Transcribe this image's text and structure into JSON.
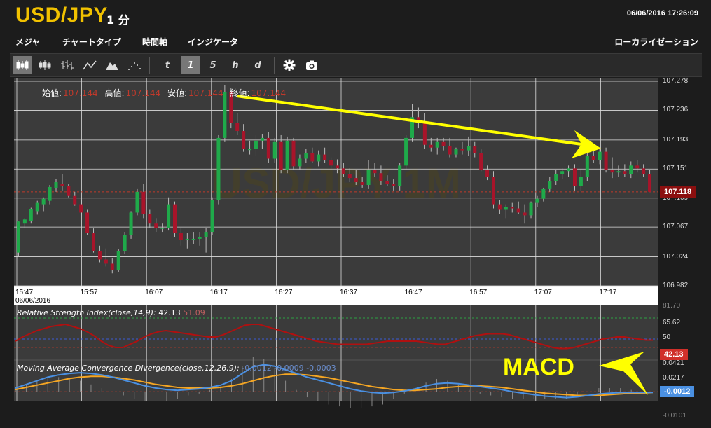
{
  "header": {
    "pair": "USD/JPY",
    "interval": "1 分",
    "datetime": "06/06/2016 17:26:09"
  },
  "menu": {
    "items": [
      "メジャ",
      "チャートタイプ",
      "時間軸",
      "インジケータ"
    ],
    "right": "ローカライゼーション"
  },
  "toolbar": {
    "chart_types": [
      "candlestick-icon",
      "ohlc-icon",
      "hlc-icon",
      "line-chart-icon",
      "mountain-chart-icon",
      "dots-chart-icon"
    ],
    "timeframes": [
      "t",
      "1",
      "5",
      "h",
      "d"
    ],
    "active_timeframe": "1",
    "tools": [
      "gear-icon",
      "camera-icon"
    ]
  },
  "legend": {
    "open_label": "始値:",
    "open_value": "107.144",
    "high_label": "高値:",
    "high_value": "107.144",
    "low_label": "安値:",
    "low_value": "107.144",
    "close_label": "終値:",
    "close_value": "107.144"
  },
  "rsi_panel": {
    "name": "Relative Strength Index",
    "params": "(close,14,9):",
    "value": "42.13",
    "value2": "51.09",
    "ticks": [
      "81.70",
      "65.62",
      "50"
    ],
    "current_badge": "42.13"
  },
  "macd_panel": {
    "name": "Moving Average Convergence Divergence",
    "params": "(close,12,26,9):",
    "values": [
      "-0.0012",
      "-0.0009",
      "-0.0003"
    ],
    "ticks": [
      "0.0421",
      "0.0217",
      "-0.0101"
    ],
    "current_badge": "-0.0012",
    "annotation": "MACD"
  },
  "colors": {
    "accent": "#f2c200",
    "up": "#1faa4a",
    "down": "#a8142a",
    "rsi_line": "#b01010",
    "macd_line": "#4a90e2",
    "signal_line": "#f5a623",
    "annotation": "#ffff00",
    "price_badge": "#8b0f0f",
    "macd_badge": "#4a90e2",
    "rsi_badge": "#d0302a"
  },
  "chart_data": {
    "type": "candlestick",
    "ylim": [
      106.982,
      107.278
    ],
    "yticks": [
      "107.278",
      "107.236",
      "107.193",
      "107.151",
      "107.109",
      "107.067",
      "107.024",
      "106.982"
    ],
    "current_price": "107.118",
    "xticks": [
      "15:47",
      "15:57",
      "16:07",
      "16:17",
      "16:27",
      "16:37",
      "16:47",
      "16:57",
      "17:07",
      "17:17"
    ],
    "date_label": "06/06/2016",
    "watermark": "USD/JPY 1M",
    "candles": [
      [
        107.03,
        107.075,
        107.025,
        107.075
      ],
      [
        107.072,
        107.08,
        107.065,
        107.078
      ],
      [
        107.076,
        107.095,
        107.072,
        107.093
      ],
      [
        107.09,
        107.105,
        107.085,
        107.102
      ],
      [
        107.1,
        107.11,
        107.09,
        107.108
      ],
      [
        107.105,
        107.128,
        107.1,
        107.125
      ],
      [
        107.123,
        107.137,
        107.118,
        107.132
      ],
      [
        107.13,
        107.144,
        107.12,
        107.126
      ],
      [
        107.126,
        107.13,
        107.11,
        107.112
      ],
      [
        107.112,
        107.118,
        107.098,
        107.1
      ],
      [
        107.1,
        107.106,
        107.085,
        107.088
      ],
      [
        107.088,
        107.092,
        107.055,
        107.058
      ],
      [
        107.058,
        107.065,
        107.03,
        107.032
      ],
      [
        107.032,
        107.04,
        107.016,
        107.02
      ],
      [
        107.02,
        107.036,
        107.01,
        107.014
      ],
      [
        107.014,
        107.022,
        107.0,
        107.005
      ],
      [
        107.005,
        107.035,
        107.002,
        107.032
      ],
      [
        107.032,
        107.06,
        107.028,
        107.056
      ],
      [
        107.056,
        107.09,
        107.05,
        107.088
      ],
      [
        107.088,
        107.122,
        107.084,
        107.118
      ],
      [
        107.118,
        107.13,
        107.08,
        107.086
      ],
      [
        107.086,
        107.092,
        107.066,
        107.072
      ],
      [
        107.072,
        107.08,
        107.06,
        107.066
      ],
      [
        107.066,
        107.072,
        107.06,
        107.066
      ],
      [
        107.066,
        107.11,
        107.062,
        107.1
      ],
      [
        107.1,
        107.104,
        107.052,
        107.058
      ],
      [
        107.058,
        107.066,
        107.04,
        107.048
      ],
      [
        107.048,
        107.058,
        107.036,
        107.05
      ],
      [
        107.05,
        107.06,
        107.042,
        107.05
      ],
      [
        107.05,
        107.06,
        107.04,
        107.052
      ],
      [
        107.052,
        107.066,
        107.03,
        107.06
      ],
      [
        107.06,
        107.11,
        107.055,
        107.106
      ],
      [
        107.106,
        107.2,
        107.1,
        107.196
      ],
      [
        107.196,
        107.272,
        107.19,
        107.262
      ],
      [
        107.262,
        107.268,
        107.21,
        107.218
      ],
      [
        107.218,
        107.232,
        107.2,
        107.206
      ],
      [
        107.206,
        107.216,
        107.176,
        107.18
      ],
      [
        107.18,
        107.192,
        107.172,
        107.18
      ],
      [
        107.18,
        107.2,
        107.17,
        107.192
      ],
      [
        107.192,
        107.202,
        107.18,
        107.196
      ],
      [
        107.196,
        107.205,
        107.16,
        107.166
      ],
      [
        107.166,
        107.196,
        107.16,
        107.19
      ],
      [
        107.19,
        107.2,
        107.145,
        107.15
      ],
      [
        107.15,
        107.198,
        107.145,
        107.192
      ],
      [
        107.192,
        107.196,
        107.15,
        107.155
      ],
      [
        107.155,
        107.172,
        107.15,
        107.166
      ],
      [
        107.166,
        107.18,
        107.16,
        107.174
      ],
      [
        107.174,
        107.182,
        107.16,
        107.162
      ],
      [
        107.162,
        107.178,
        107.155,
        107.172
      ],
      [
        107.172,
        107.182,
        107.16,
        107.164
      ],
      [
        107.164,
        107.168,
        107.15,
        107.156
      ],
      [
        107.156,
        107.165,
        107.145,
        107.152
      ],
      [
        107.152,
        107.16,
        107.14,
        107.144
      ],
      [
        107.144,
        107.152,
        107.132,
        107.138
      ],
      [
        107.138,
        107.15,
        107.128,
        107.132
      ],
      [
        107.132,
        107.14,
        107.124,
        107.128
      ],
      [
        107.128,
        107.164,
        107.122,
        107.15
      ],
      [
        107.15,
        107.16,
        107.14,
        107.145
      ],
      [
        107.145,
        107.156,
        107.128,
        107.134
      ],
      [
        107.134,
        107.142,
        107.126,
        107.13
      ],
      [
        107.13,
        107.136,
        107.12,
        107.126
      ],
      [
        107.126,
        107.16,
        107.12,
        107.156
      ],
      [
        107.156,
        107.2,
        107.15,
        107.196
      ],
      [
        107.196,
        107.245,
        107.19,
        107.226
      ],
      [
        107.226,
        107.24,
        107.21,
        107.22
      ],
      [
        107.22,
        107.232,
        107.18,
        107.186
      ],
      [
        107.186,
        107.196,
        107.176,
        107.182
      ],
      [
        107.182,
        107.196,
        107.172,
        107.19
      ],
      [
        107.19,
        107.196,
        107.178,
        107.184
      ],
      [
        107.184,
        107.196,
        107.168,
        107.172
      ],
      [
        107.172,
        107.182,
        107.168,
        107.18
      ],
      [
        107.18,
        107.19,
        107.172,
        107.178
      ],
      [
        107.178,
        107.198,
        107.17,
        107.184
      ],
      [
        107.184,
        107.19,
        107.168,
        107.174
      ],
      [
        107.174,
        107.18,
        107.148,
        107.15
      ],
      [
        107.15,
        107.156,
        107.135,
        107.14
      ],
      [
        107.14,
        107.148,
        107.094,
        107.1
      ],
      [
        107.1,
        107.106,
        107.086,
        107.092
      ],
      [
        107.092,
        107.1,
        107.08,
        107.096
      ],
      [
        107.096,
        107.102,
        107.088,
        107.094
      ],
      [
        107.094,
        107.104,
        107.086,
        107.088
      ],
      [
        107.088,
        107.1,
        107.072,
        107.084
      ],
      [
        107.084,
        107.104,
        107.08,
        107.102
      ],
      [
        107.102,
        107.112,
        107.096,
        107.108
      ],
      [
        107.108,
        107.124,
        107.104,
        107.122
      ],
      [
        107.122,
        107.14,
        107.118,
        107.134
      ],
      [
        107.134,
        107.15,
        107.128,
        107.144
      ],
      [
        107.144,
        107.152,
        107.136,
        107.148
      ],
      [
        107.148,
        107.156,
        107.14,
        107.152
      ],
      [
        107.152,
        107.158,
        107.12,
        107.126
      ],
      [
        107.126,
        107.15,
        107.12,
        107.14
      ],
      [
        107.14,
        107.176,
        107.134,
        107.17
      ],
      [
        107.17,
        107.18,
        107.16,
        107.164
      ],
      [
        107.164,
        107.182,
        107.158,
        107.176
      ],
      [
        107.176,
        107.182,
        107.146,
        107.15
      ],
      [
        107.15,
        107.168,
        107.138,
        107.146
      ],
      [
        107.146,
        107.156,
        107.14,
        107.148
      ],
      [
        107.148,
        107.158,
        107.14,
        107.144
      ],
      [
        107.144,
        107.162,
        107.138,
        107.156
      ],
      [
        107.156,
        107.164,
        107.146,
        107.152
      ],
      [
        107.152,
        107.158,
        107.14,
        107.144
      ],
      [
        107.144,
        107.15,
        107.12,
        107.118
      ]
    ],
    "rsi": [
      48,
      52,
      55,
      58,
      60,
      62,
      63,
      64,
      62,
      60,
      57,
      53,
      48,
      44,
      42,
      42,
      45,
      48,
      52,
      55,
      57,
      58,
      57,
      56,
      55,
      54,
      53,
      52,
      52,
      54,
      57,
      60,
      63,
      64,
      64,
      62,
      60,
      58,
      56,
      54,
      52,
      50,
      48,
      47,
      46,
      45,
      45,
      45,
      45,
      45,
      46,
      47,
      48,
      48,
      48,
      48,
      48,
      47,
      46,
      45,
      45,
      47,
      49,
      51,
      53,
      54,
      55,
      55,
      55,
      54,
      52,
      50,
      48,
      46,
      44,
      42,
      41,
      41,
      42,
      44,
      46,
      48,
      50,
      51,
      52,
      52,
      51,
      50,
      49,
      49
    ],
    "macd": [
      0.005,
      0.01,
      0.015,
      0.02,
      0.023,
      0.025,
      0.026,
      0.025,
      0.023,
      0.02,
      0.016,
      0.012,
      0.008,
      0.005,
      0.003,
      0.002,
      0.003,
      0.004,
      0.006,
      0.009,
      0.015,
      0.025,
      0.034,
      0.037,
      0.035,
      0.03,
      0.025,
      0.02,
      0.016,
      0.012,
      0.008,
      0.004,
      0.001,
      -0.001,
      -0.002,
      -0.001,
      0.001,
      0.004,
      0.008,
      0.011,
      0.012,
      0.011,
      0.009,
      0.007,
      0.005,
      0.003,
      0.0,
      -0.002,
      -0.004,
      -0.006,
      -0.007,
      -0.008,
      -0.007,
      -0.005,
      -0.003,
      -0.002,
      -0.001,
      -0.001,
      -0.001,
      -0.001
    ],
    "signal": [
      0.003,
      0.006,
      0.009,
      0.012,
      0.015,
      0.018,
      0.02,
      0.021,
      0.021,
      0.02,
      0.018,
      0.016,
      0.013,
      0.01,
      0.008,
      0.006,
      0.005,
      0.005,
      0.005,
      0.006,
      0.008,
      0.011,
      0.015,
      0.019,
      0.022,
      0.024,
      0.024,
      0.023,
      0.021,
      0.019,
      0.016,
      0.013,
      0.01,
      0.007,
      0.005,
      0.003,
      0.002,
      0.002,
      0.003,
      0.004,
      0.006,
      0.007,
      0.008,
      0.008,
      0.007,
      0.006,
      0.004,
      0.002,
      0.0,
      -0.002,
      -0.003,
      -0.004,
      -0.005,
      -0.005,
      -0.005,
      -0.004,
      -0.003,
      -0.002,
      -0.002,
      -0.001
    ]
  }
}
